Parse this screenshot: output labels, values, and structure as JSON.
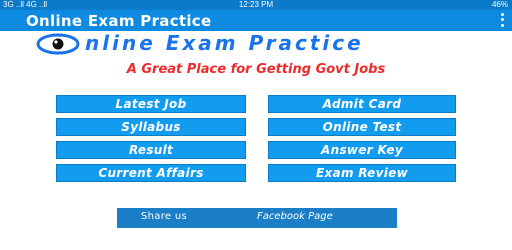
{
  "statusbar": {
    "network": "3G ..ll 4G ..ll",
    "time": "12:23 PM",
    "battery": "46%"
  },
  "appbar": {
    "title": "Online Exam Practice",
    "menu_icon": "overflow-menu-icon"
  },
  "logo": {
    "brand_text": "nline Exam Practice",
    "icon": "eye-logo-icon"
  },
  "tagline": "A Great Place for Getting Govt Jobs",
  "menu": {
    "latest_job": "Latest Job",
    "admit_card": "Admit Card",
    "syllabus": "Syllabus",
    "online_test": "Online Test",
    "result": "Result",
    "answer_key": "Answer Key",
    "current_affairs": "Current Affairs",
    "exam_review": "Exam Review"
  },
  "share": {
    "label": "Share us",
    "link": "Facebook Page"
  },
  "colors": {
    "statusbar": "#0b7ac9",
    "appbar": "#0e8be0",
    "button": "#129cf0",
    "tagline": "#ee2b2b",
    "brand": "#1a73e8",
    "share_bar": "#1a7fc6"
  }
}
